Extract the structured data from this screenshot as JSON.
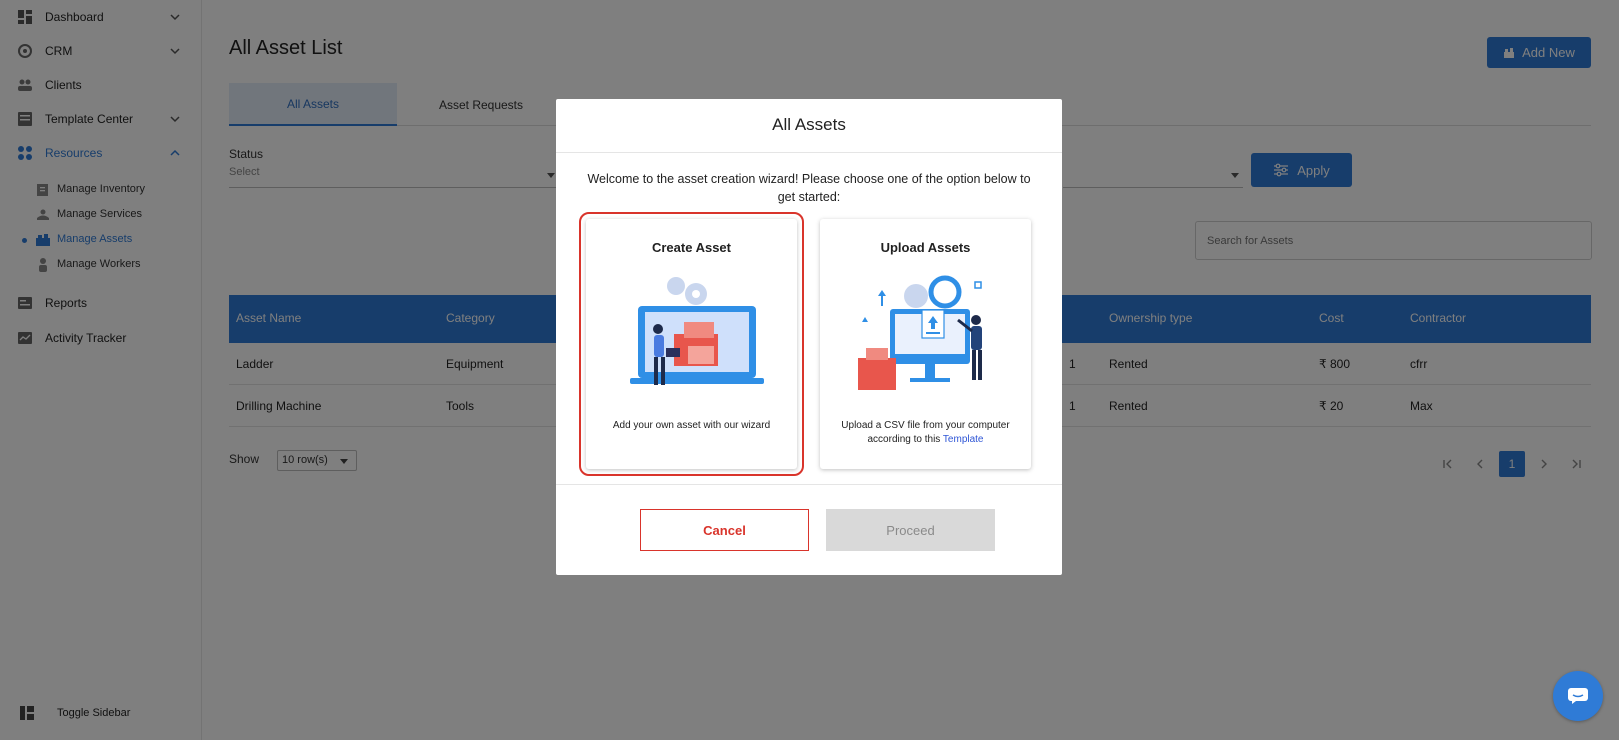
{
  "sidebar": {
    "items": [
      {
        "label": "Dashboard",
        "icon": "dashboard-icon"
      },
      {
        "label": "CRM",
        "icon": "crm-icon"
      },
      {
        "label": "Clients",
        "icon": "clients-icon"
      },
      {
        "label": "Template Center",
        "icon": "template-icon"
      },
      {
        "label": "Resources",
        "icon": "resources-icon"
      },
      {
        "label": "Reports",
        "icon": "reports-icon"
      },
      {
        "label": "Activity Tracker",
        "icon": "activity-icon"
      }
    ],
    "sub_items": [
      {
        "label": "Manage Inventory"
      },
      {
        "label": "Manage Services"
      },
      {
        "label": "Manage Assets"
      },
      {
        "label": "Manage Workers"
      }
    ],
    "toggle_label": "Toggle Sidebar"
  },
  "main": {
    "title": "All Asset List",
    "add_new_label": "Add New",
    "tabs": [
      {
        "label": "All Assets"
      },
      {
        "label": "Asset Requests"
      }
    ],
    "status_label": "Status",
    "status_placeholder": "Select",
    "apply_label": "Apply",
    "search_placeholder": "Search for Assets",
    "table": {
      "columns": [
        "Asset Name",
        "Category",
        "Ownership type",
        "Cost",
        "Contractor"
      ],
      "rows": [
        {
          "name": "Ladder",
          "category": "Equipment",
          "qty": "1",
          "ownership": "Rented",
          "cost": "₹ 800",
          "contractor": "cfrr"
        },
        {
          "name": "Drilling Machine",
          "category": "Tools",
          "qty": "1",
          "ownership": "Rented",
          "cost": "₹ 20",
          "contractor": "Max"
        }
      ]
    },
    "show_label": "Show",
    "rows_per_page": "10 row(s)",
    "current_page": "1"
  },
  "modal": {
    "title": "All Assets",
    "intro": "Welcome to the asset creation wizard! Please choose one of the option below to get started:",
    "create_card": {
      "title": "Create Asset",
      "desc": "Add your own asset with our wizard"
    },
    "upload_card": {
      "title": "Upload Assets",
      "desc": "Upload a CSV file from your computer according to this",
      "link": "Template"
    },
    "cancel_label": "Cancel",
    "proceed_label": "Proceed"
  },
  "colors": {
    "accent": "#2f7bd6",
    "danger": "#d9342b"
  }
}
